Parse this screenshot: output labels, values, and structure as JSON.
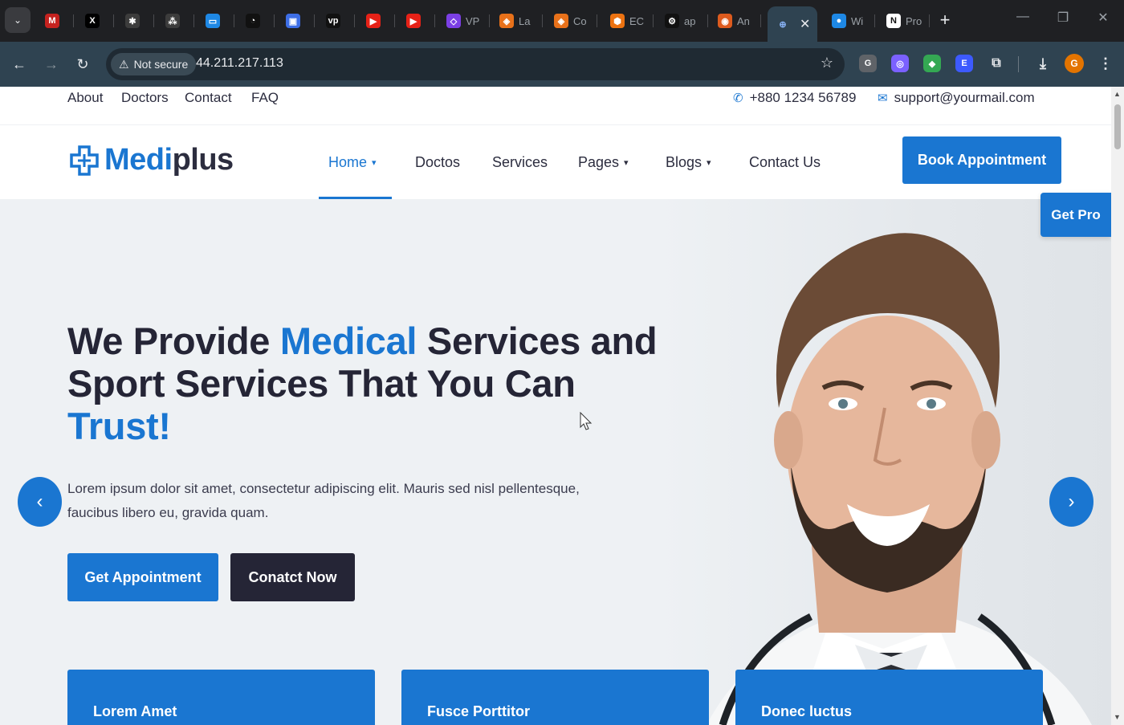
{
  "browser": {
    "tabs": [
      {
        "icon": "gmail-icon",
        "title": "",
        "color": "#c5221f",
        "glyph": "M"
      },
      {
        "icon": "x-icon",
        "title": "",
        "color": "#000000",
        "glyph": "X"
      },
      {
        "icon": "chatgpt-icon",
        "title": "",
        "color": "#3c3c3c",
        "glyph": "✱"
      },
      {
        "icon": "sitemap-icon",
        "title": "",
        "color": "#3c3c3c",
        "glyph": "⁂"
      },
      {
        "icon": "laptop-icon",
        "title": "",
        "color": "#1e88e5",
        "glyph": "▭"
      },
      {
        "icon": "circle-logo-icon",
        "title": "",
        "color": "#111111",
        "glyph": "◔"
      },
      {
        "icon": "app-icon",
        "title": "",
        "color": "#3d6ee6",
        "glyph": "▣"
      },
      {
        "icon": "vp-icon",
        "title": "",
        "color": "#111111",
        "glyph": "vp"
      },
      {
        "icon": "youtube-icon",
        "title": "",
        "color": "#e62117",
        "glyph": "▶"
      },
      {
        "icon": "youtube-icon",
        "title": "",
        "color": "#e62117",
        "glyph": "▶"
      },
      {
        "icon": "vpn-icon",
        "title": "VP",
        "color": "#7b3fe4",
        "glyph": "◇"
      },
      {
        "icon": "laravel-icon",
        "title": "La",
        "color": "#e8711a",
        "glyph": "◈"
      },
      {
        "icon": "laravel-icon",
        "title": "Co",
        "color": "#e8711a",
        "glyph": "◈"
      },
      {
        "icon": "aws-ec2-icon",
        "title": "EC",
        "color": "#ec7211",
        "glyph": "⬢"
      },
      {
        "icon": "api-icon",
        "title": "ap",
        "color": "#111111",
        "glyph": "⚙"
      },
      {
        "icon": "angular-icon",
        "title": "An",
        "color": "#dd5b1e",
        "glyph": "◉"
      }
    ],
    "active_tab": {
      "icon": "globe-icon",
      "title": ""
    },
    "after_tabs": [
      {
        "icon": "world-icon",
        "title": "Wi",
        "color": "#1e88e5",
        "glyph": "●"
      },
      {
        "icon": "notion-icon",
        "title": "Pro",
        "color": "#ffffff",
        "glyph": "N"
      }
    ],
    "security_label": "Not secure",
    "url": "44.211.217.113",
    "profile_initial": "G"
  },
  "site": {
    "topbar": {
      "links": [
        "About",
        "Doctors",
        "Contact",
        "FAQ"
      ],
      "phone": "+880 1234 56789",
      "email": "support@yourmail.com"
    },
    "logo": {
      "part1": "Medi",
      "part2": "plus"
    },
    "menu": [
      "Home",
      "Doctos",
      "Services",
      "Pages",
      "Blogs",
      "Contact Us"
    ],
    "book_button": "Book Appointment",
    "get_pro": "Get Pro",
    "hero": {
      "title_1": "We Provide ",
      "title_hl1": "Medical",
      "title_2": " Services and Sport Services That You Can ",
      "title_hl2": "Trust!",
      "text": "Lorem ipsum dolor sit amet, consectetur adipiscing elit. Mauris sed nisl pellentesque, faucibus libero eu, gravida quam.",
      "primary_button": "Get Appointment",
      "secondary_button": "Conatct Now"
    },
    "features": [
      "Lorem Amet",
      "Fusce Porttitor",
      "Donec luctus"
    ]
  },
  "colors": {
    "accent": "#1a76d1",
    "dark": "#252536"
  }
}
